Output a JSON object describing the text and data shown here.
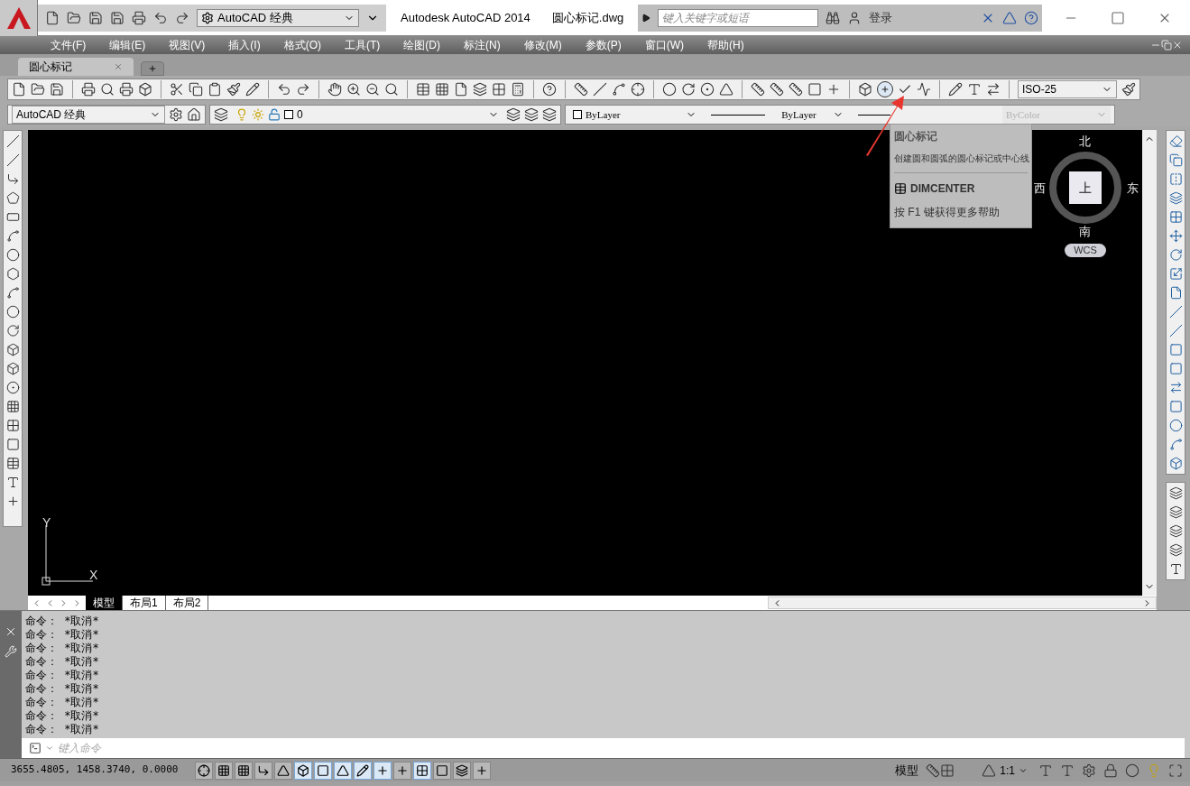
{
  "title_bar": {
    "workspace": "AutoCAD 经典",
    "app_title": "Autodesk AutoCAD 2014",
    "file_name": "圆心标记.dwg",
    "search_placeholder": "键入关键字或短语",
    "sign_in": "登录"
  },
  "menu_bar": [
    "文件(F)",
    "编辑(E)",
    "视图(V)",
    "插入(I)",
    "格式(O)",
    "工具(T)",
    "绘图(D)",
    "标注(N)",
    "修改(M)",
    "参数(P)",
    "窗口(W)",
    "帮助(H)"
  ],
  "document_tabs": [
    {
      "label": "圆心标记",
      "selected": true
    }
  ],
  "toolbar": {
    "workspace": "AutoCAD 经典",
    "layer": "0",
    "color_dropdown": "ByLayer",
    "linetype": "ByLayer",
    "plot_style": "ByColor",
    "dim_style": "ISO-25"
  },
  "tooltip": {
    "title": "圆心标记",
    "description": "创建圆和圆弧的圆心标记或中心线",
    "command": "DIMCENTER",
    "help": "按 F1 键获得更多帮助"
  },
  "viewcube": {
    "north": "北",
    "south": "南",
    "east": "东",
    "west": "西",
    "face": "上",
    "ucs": "WCS"
  },
  "ucs_icon": {
    "x": "X",
    "y": "Y"
  },
  "layout_tabs": [
    {
      "label": "模型",
      "selected": true
    },
    {
      "label": "布局1",
      "selected": false
    },
    {
      "label": "布局2",
      "selected": false
    }
  ],
  "command_history": [
    "命令： *取消*",
    "命令： *取消*",
    "命令： *取消*",
    "命令： *取消*",
    "命令： *取消*",
    "命令： *取消*",
    "命令： *取消*",
    "命令： *取消*",
    "命令： *取消*"
  ],
  "command_placeholder": "键入命令",
  "status_bar": {
    "coordinates": "3655.4805, 1458.3740, 0.0000",
    "space": "模型",
    "scale": "1:1",
    "toggles": [
      {
        "on": false
      },
      {
        "on": false
      },
      {
        "on": false
      },
      {
        "on": false
      },
      {
        "on": false
      },
      {
        "on": true
      },
      {
        "on": true
      },
      {
        "on": true
      },
      {
        "on": true
      },
      {
        "on": true
      },
      {
        "on": false
      },
      {
        "on": true
      },
      {
        "on": false
      },
      {
        "on": false
      },
      {
        "on": false
      }
    ]
  }
}
